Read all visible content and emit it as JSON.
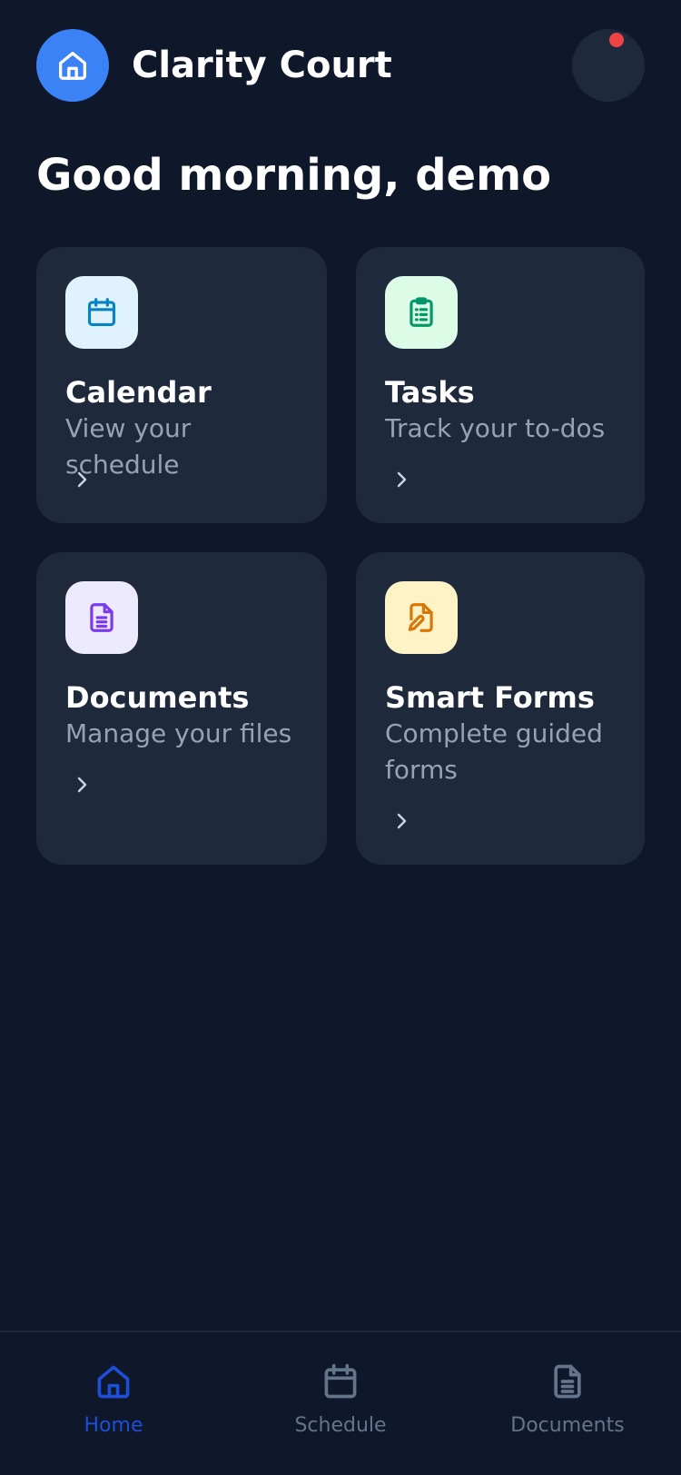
{
  "header": {
    "app_name": "Clarity Court",
    "logo_icon": "home-icon",
    "has_notification": true
  },
  "greeting": "Good morning, demo",
  "cards": [
    {
      "id": "calendar",
      "title": "Calendar",
      "description": "View your schedule",
      "icon": "calendar-icon",
      "icon_bg": "#e0f2fe",
      "icon_color": "#0284c7"
    },
    {
      "id": "tasks",
      "title": "Tasks",
      "description": "Track your to-dos",
      "icon": "clipboard-list-icon",
      "icon_bg": "#dcfce7",
      "icon_color": "#059669"
    },
    {
      "id": "documents",
      "title": "Documents",
      "description": "Manage your files",
      "icon": "file-text-icon",
      "icon_bg": "#ede9fe",
      "icon_color": "#7c3aed"
    },
    {
      "id": "smart-forms",
      "title": "Smart Forms",
      "description": "Complete guided forms",
      "icon": "file-signature-icon",
      "icon_bg": "#fef3c7",
      "icon_color": "#d97706"
    }
  ],
  "bottom_nav": [
    {
      "label": "Home",
      "icon": "home-icon",
      "active": true
    },
    {
      "label": "Schedule",
      "icon": "calendar-icon",
      "active": false
    },
    {
      "label": "Documents",
      "icon": "file-text-icon",
      "active": false
    }
  ],
  "colors": {
    "background": "#0f172a",
    "card": "#1e293b",
    "accent": "#3b82f6",
    "nav_active": "#1d4ed8",
    "nav_inactive": "#64748b",
    "notification": "#ef4444",
    "muted_text": "#94a3b8"
  }
}
